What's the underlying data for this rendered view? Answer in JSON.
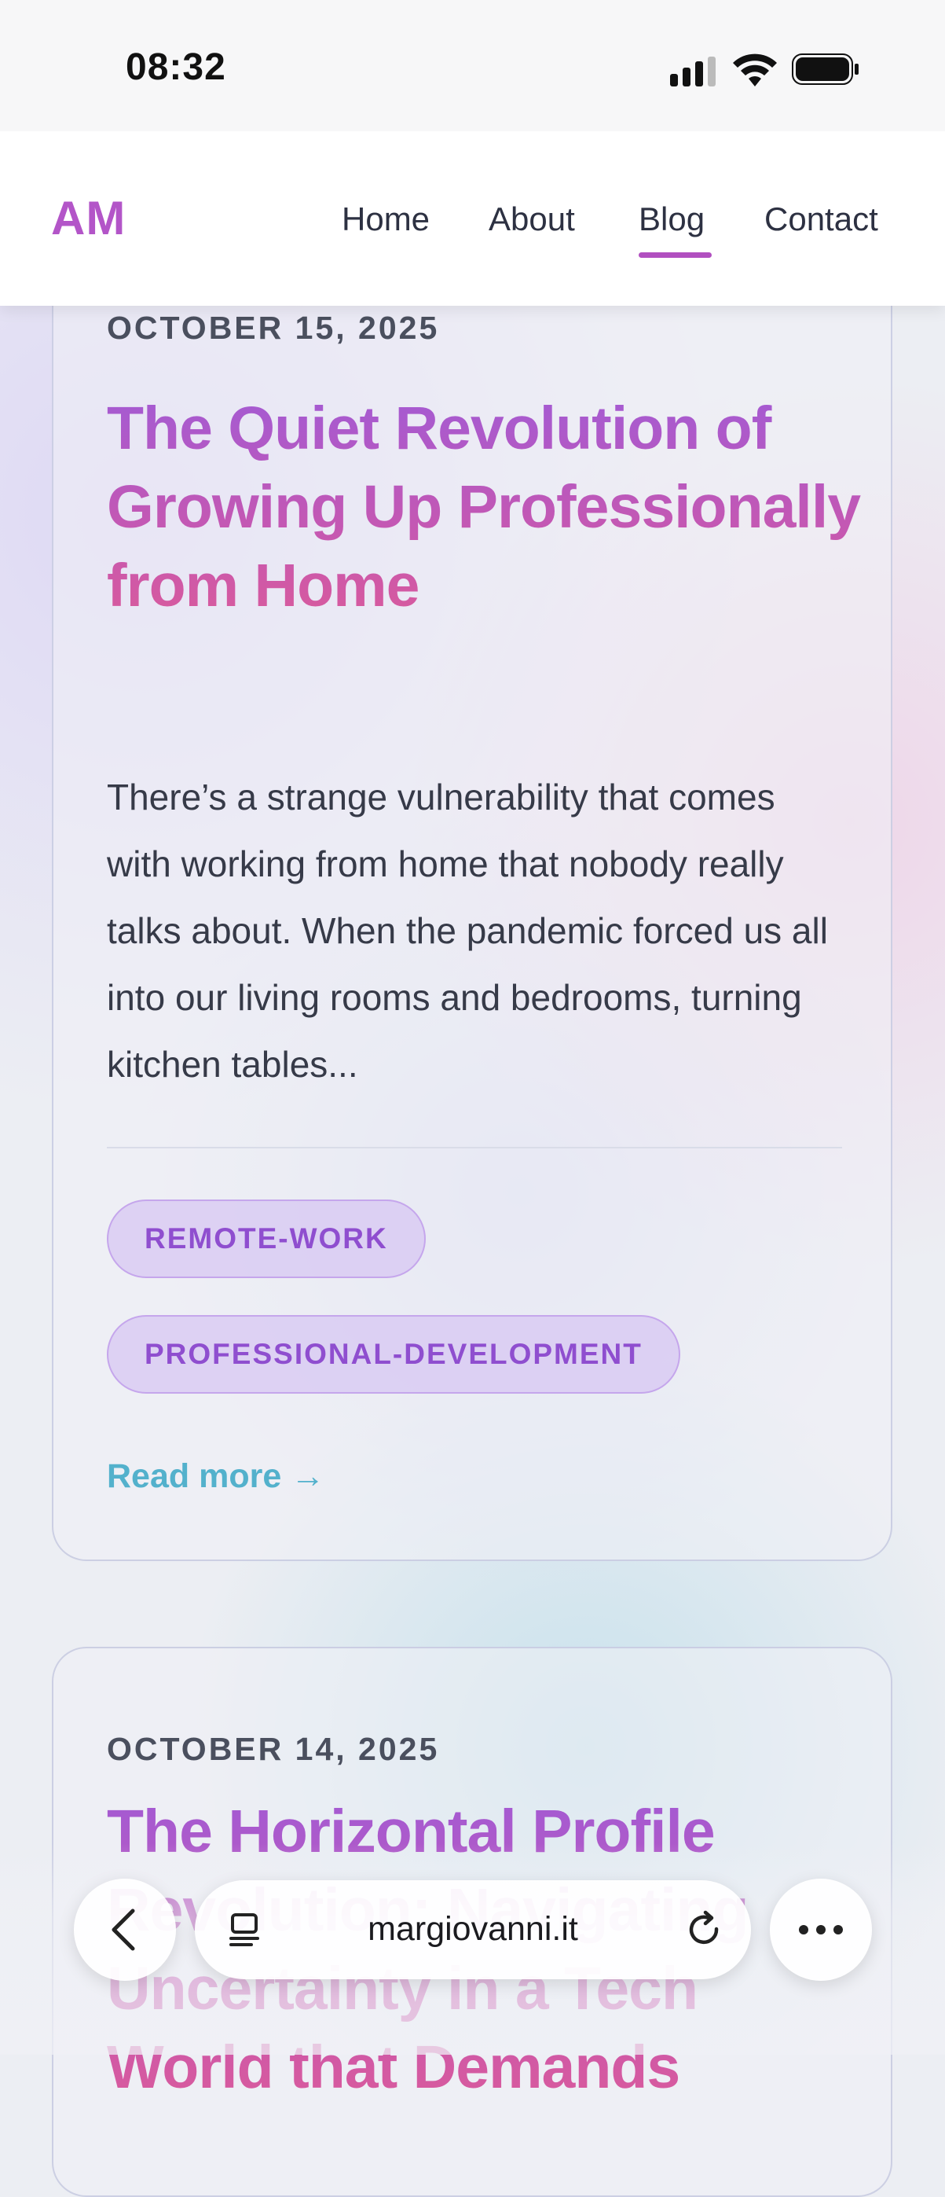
{
  "status_bar": {
    "time": "08:32"
  },
  "header": {
    "logo": "AM",
    "nav": [
      {
        "label": "Home"
      },
      {
        "label": "About"
      },
      {
        "label": "Blog",
        "active": true
      },
      {
        "label": "Contact"
      }
    ]
  },
  "posts": [
    {
      "date": "OCTOBER 15, 2025",
      "title": "The Quiet Revolution of Growing Up Professionally from Home",
      "excerpt": "There’s a strange vulnerability that comes with working from home that nobody really talks about. When the pandemic forced us all into our living rooms and bedrooms, turning kitchen tables...",
      "tags": [
        "REMOTE-WORK",
        "PROFESSIONAL-DEVELOPMENT"
      ],
      "read_more": "Read more →"
    },
    {
      "date": "OCTOBER 14, 2025",
      "title": "The Horizontal Profile Revolution: Navigating Uncertainty in a Tech World that Demands"
    }
  ],
  "browser": {
    "url": "margiovanni.it",
    "icons": [
      "back-chevron-icon",
      "reader-mode-icon",
      "reload-icon",
      "more-dots-icon"
    ]
  },
  "colors": {
    "accent": "#b355c8",
    "link": "#53b1cc",
    "tag_text": "#8f4ecf"
  }
}
